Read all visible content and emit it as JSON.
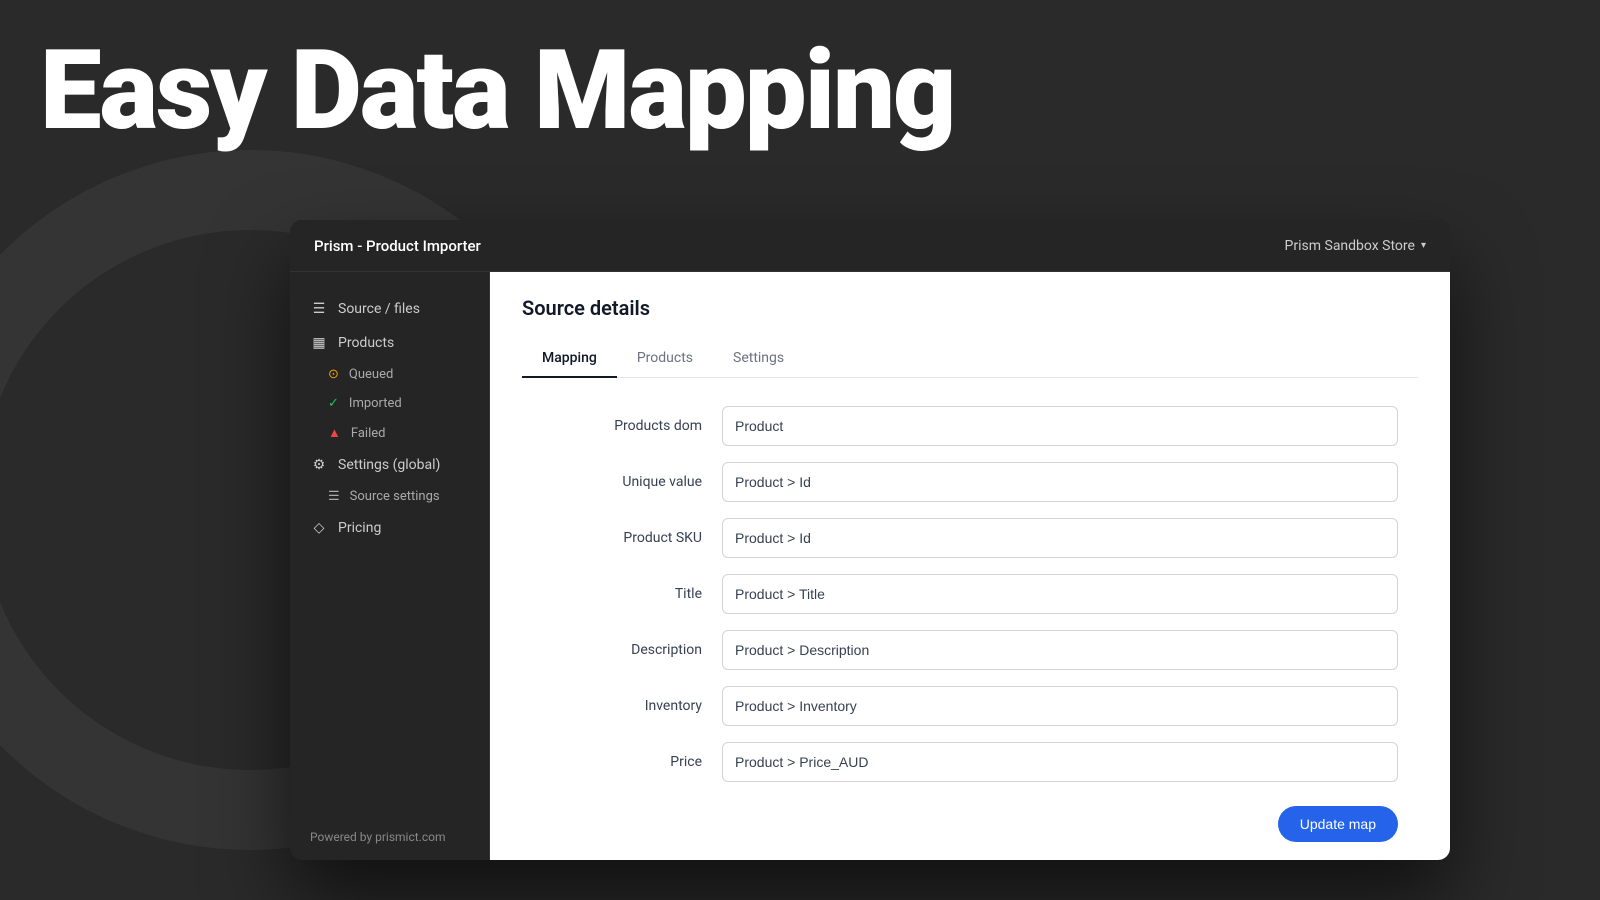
{
  "hero": {
    "title": "Easy Data Mapping"
  },
  "app": {
    "header": {
      "title": "Prism - Product Importer",
      "store_label": "Prism Sandbox Store",
      "chevron": "▾"
    },
    "sidebar": {
      "items": [
        {
          "id": "source-files",
          "label": "Source / files",
          "icon": "☰"
        },
        {
          "id": "products",
          "label": "Products",
          "icon": "📅"
        },
        {
          "id": "queued",
          "label": "Queued",
          "icon": "⊙",
          "sub": true,
          "type": "queued"
        },
        {
          "id": "imported",
          "label": "Imported",
          "icon": "✓",
          "sub": true,
          "type": "imported"
        },
        {
          "id": "failed",
          "label": "Failed",
          "icon": "▲",
          "sub": true,
          "type": "failed"
        },
        {
          "id": "settings-global",
          "label": "Settings (global)",
          "icon": "⚙"
        },
        {
          "id": "source-settings",
          "label": "Source settings",
          "icon": "☰",
          "sub": true
        },
        {
          "id": "pricing",
          "label": "Pricing",
          "icon": "◇"
        }
      ],
      "powered_by_prefix": "Powered by ",
      "powered_by_link": "prismict.com"
    },
    "main": {
      "section_title": "Source details",
      "tabs": [
        {
          "id": "mapping",
          "label": "Mapping",
          "active": true
        },
        {
          "id": "products",
          "label": "Products",
          "active": false
        },
        {
          "id": "settings",
          "label": "Settings",
          "active": false
        }
      ],
      "form": {
        "fields": [
          {
            "label": "Products dom",
            "value": "Product"
          },
          {
            "label": "Unique value",
            "value": "Product > Id"
          },
          {
            "label": "Product SKU",
            "value": "Product > Id"
          },
          {
            "label": "Title",
            "value": "Product > Title"
          },
          {
            "label": "Description",
            "value": "Product > Description"
          },
          {
            "label": "Inventory",
            "value": "Product > Inventory"
          },
          {
            "label": "Price",
            "value": "Product > Price_AUD"
          }
        ],
        "update_button": "Update map"
      }
    }
  }
}
